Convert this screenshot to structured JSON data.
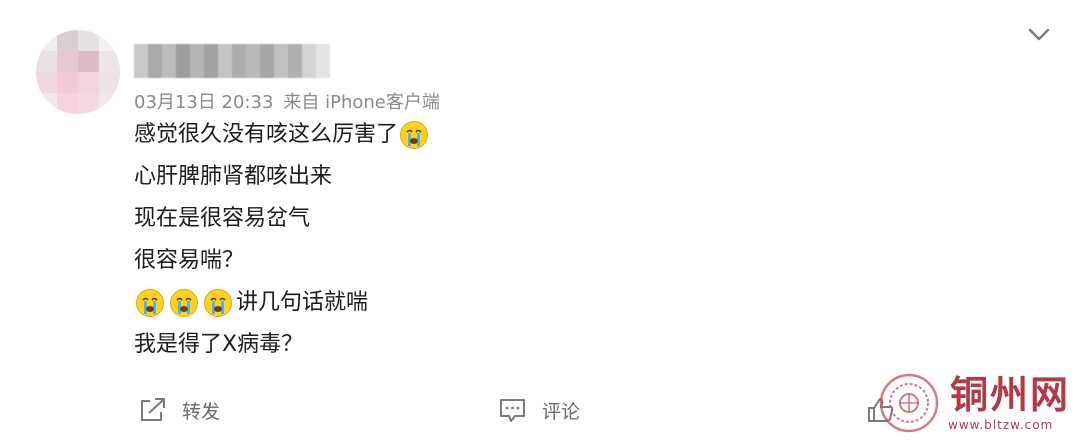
{
  "post": {
    "timestamp": "03月13日 20:33",
    "source": "来自 iPhone客户端",
    "lines": [
      "感觉很久没有咳这么厉害了",
      "心肝脾肺肾都咳出来",
      "现在是很容易岔气",
      "很容易喘？",
      "讲几句话就喘",
      "我是得了X病毒？"
    ],
    "emoji": "crying-face-icon"
  },
  "actions": {
    "repost_label": "转发",
    "comment_label": "评论"
  },
  "watermark": {
    "brand": "铜州网",
    "url": "www.bltzw.com"
  },
  "colors": {
    "text": "#1c1c1c",
    "meta": "#8a8a8a",
    "action": "#6b6b6b",
    "watermark": "#b23a45"
  }
}
